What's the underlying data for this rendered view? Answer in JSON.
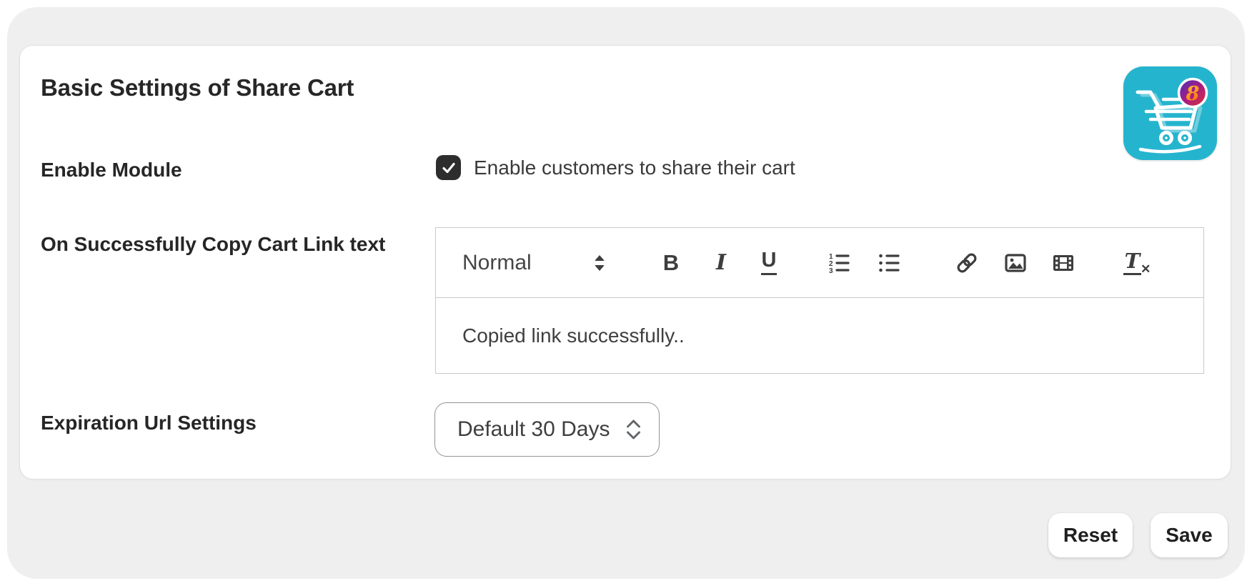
{
  "card": {
    "title": "Basic Settings of Share Cart"
  },
  "app_icon": {
    "name": "share-cart-app-icon",
    "background_color": "#25b4ce",
    "badge_glyph": "8"
  },
  "rows": {
    "enable_module": {
      "label": "Enable Module",
      "checkbox_checked": true,
      "checkbox_label": "Enable customers to share their cart"
    },
    "copy_link_text": {
      "label": "On Successfully Copy Cart Link text"
    },
    "expiration": {
      "label": "Expiration Url Settings",
      "value": "Default 30 Days"
    }
  },
  "editor": {
    "format_label": "Normal",
    "content": "Copied link successfully..",
    "toolbar_icons": [
      "format-picker-arrows",
      "bold",
      "italic",
      "underline",
      "ordered-list",
      "bullet-list",
      "link",
      "image",
      "video",
      "clear-formatting"
    ],
    "glyphs": {
      "bold": "B",
      "italic": "I",
      "underline": "U",
      "clean_t": "T",
      "clean_x": "✕",
      "ol_numbers": [
        "1",
        "2",
        "3"
      ]
    }
  },
  "actions": {
    "reset_label": "Reset",
    "save_label": "Save"
  },
  "colors": {
    "panel_background": "#efefef",
    "card_background": "#ffffff",
    "accent_teal": "#25b4ce",
    "checkbox_background": "#2d2d2d",
    "editor_border": "#c9c9c9",
    "text_primary": "#262626"
  }
}
